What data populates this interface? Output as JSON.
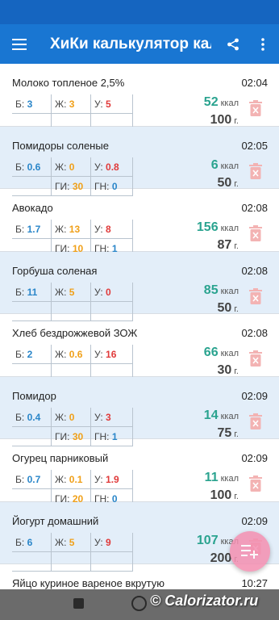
{
  "colors": {
    "appbar": "#1976d2",
    "kcal": "#2aa38f",
    "protein": "#2a86c9",
    "fat": "#f0a019",
    "carbs": "#e03a3a"
  },
  "appbar": {
    "title": "ХиКи калькулятор кал…",
    "menu_icon": "hamburger-icon",
    "share_icon": "share-icon",
    "more_icon": "more-vert-icon"
  },
  "labels": {
    "protein": "Б:",
    "fat": "Ж:",
    "carbs": "У:",
    "gi": "ГИ:",
    "gn": "ГН:",
    "kcal_unit": "ккал",
    "gram_unit": "г."
  },
  "items": [
    {
      "name": "Молоко топленое 2,5%",
      "time": "02:04",
      "b": "3",
      "zh": "3",
      "u": "5",
      "gi": "",
      "gn": "",
      "kcal": "52",
      "grams": "100"
    },
    {
      "name": "Помидоры соленые",
      "time": "02:05",
      "b": "0.6",
      "zh": "0",
      "u": "0.8",
      "gi": "30",
      "gn": "0",
      "kcal": "6",
      "grams": "50"
    },
    {
      "name": "Авокадо",
      "time": "02:08",
      "b": "1.7",
      "zh": "13",
      "u": "8",
      "gi": "10",
      "gn": "1",
      "kcal": "156",
      "grams": "87"
    },
    {
      "name": "Горбуша соленая",
      "time": "02:08",
      "b": "11",
      "zh": "5",
      "u": "0",
      "gi": "",
      "gn": "",
      "kcal": "85",
      "grams": "50"
    },
    {
      "name": "Хлеб бездрожжевой ЗОЖ",
      "time": "02:08",
      "b": "2",
      "zh": "0.6",
      "u": "16",
      "gi": "",
      "gn": "",
      "kcal": "66",
      "grams": "30"
    },
    {
      "name": "Помидор",
      "time": "02:09",
      "b": "0.4",
      "zh": "0",
      "u": "3",
      "gi": "30",
      "gn": "1",
      "kcal": "14",
      "grams": "75"
    },
    {
      "name": "Огурец парниковый",
      "time": "02:09",
      "b": "0.7",
      "zh": "0.1",
      "u": "1.9",
      "gi": "20",
      "gn": "0",
      "kcal": "11",
      "grams": "100"
    },
    {
      "name": "Йогурт домашний",
      "time": "02:09",
      "b": "6",
      "zh": "5",
      "u": "9",
      "gi": "",
      "gn": "",
      "kcal": "107",
      "grams": "200"
    },
    {
      "name": "Яйцо куриное вареное вкрутую",
      "time": "10:27",
      "b": "",
      "zh": "",
      "u": "",
      "gi": "",
      "gn": "",
      "kcal": "",
      "grams": ""
    }
  ],
  "fab": {
    "icon": "add-list-icon"
  },
  "watermark": {
    "text": "© Calorizator.ru"
  }
}
